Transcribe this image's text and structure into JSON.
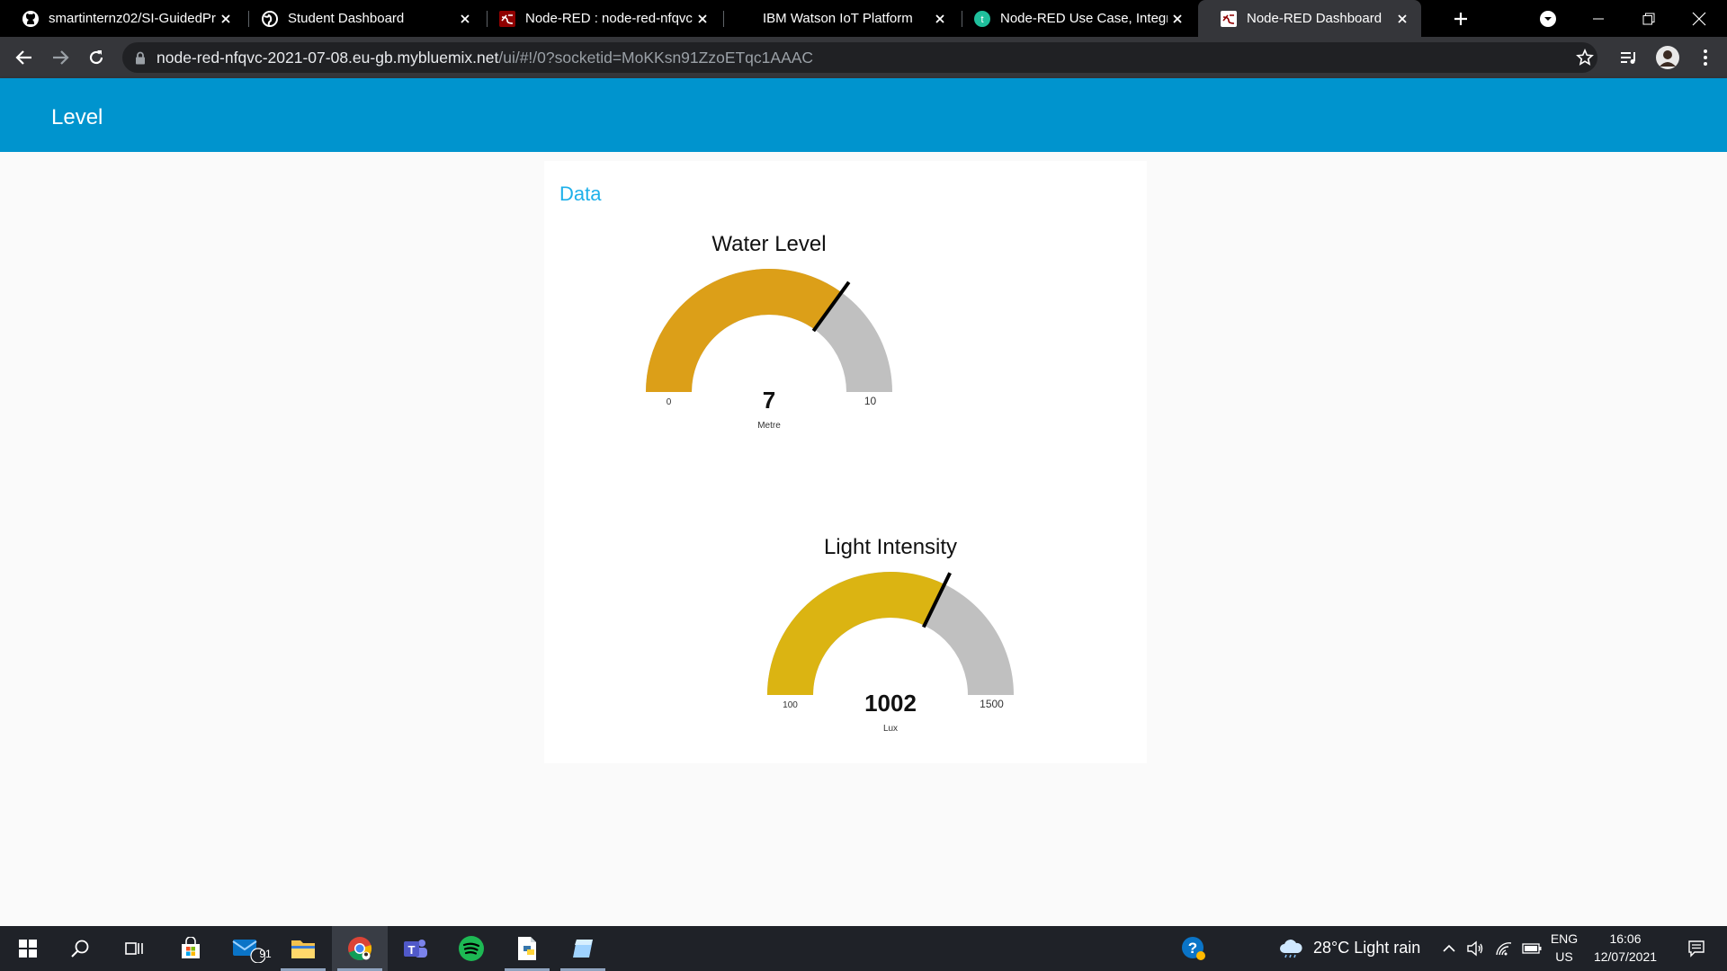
{
  "browser": {
    "tabs": [
      {
        "title": "smartinternz02/SI-GuidedPr",
        "icon": "github-icon"
      },
      {
        "title": "Student Dashboard",
        "icon": "globe-icon"
      },
      {
        "title": "Node-RED : node-red-nfqvc",
        "icon": "node-red-icon"
      },
      {
        "title": "IBM Watson IoT Platform",
        "icon": "ibm-icon"
      },
      {
        "title": "Node-RED Use Case, Integr",
        "icon": "teal-circle-icon"
      },
      {
        "title": "Node-RED Dashboard",
        "icon": "node-red-icon",
        "active": true
      }
    ],
    "url_host": "node-red-nfqvc-2021-07-08.eu-gb.mybluemix.net",
    "url_path": "/ui/#!/0?socketid=MoKKsn91ZzoETqc1AAAC"
  },
  "dashboard": {
    "title": "Level",
    "header_color": "#0094ce",
    "group_title": "Data",
    "gauges": [
      {
        "title": "Water Level",
        "value": "7",
        "units": "Metre",
        "min": "0",
        "max": "10",
        "fraction": 0.7,
        "color": "#dc9f18",
        "track": "#c0c0c0"
      },
      {
        "title": "Light Intensity",
        "value": "1002",
        "units": "Lux",
        "min": "100",
        "max": "1500",
        "fraction": 0.6443,
        "color": "#dbb412",
        "track": "#c0c0c0"
      }
    ]
  },
  "taskbar": {
    "mail_badge": "91",
    "weather": "28°C  Light rain",
    "lang_top": "ENG",
    "lang_bottom": "US",
    "time": "16:06",
    "date": "12/07/2021"
  }
}
